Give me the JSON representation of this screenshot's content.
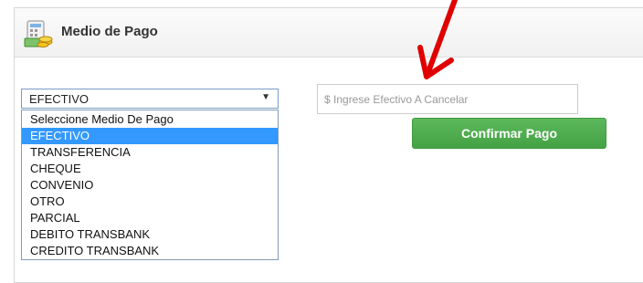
{
  "panel": {
    "title": "Medio de Pago"
  },
  "payment_select": {
    "selected": "EFECTIVO",
    "options": [
      "Seleccione Medio De Pago",
      "EFECTIVO",
      "TRANSFERENCIA",
      "CHEQUE",
      "CONVENIO",
      "OTRO",
      "PARCIAL",
      "DEBITO TRANSBANK",
      "CREDITO TRANSBANK"
    ],
    "highlighted_option": "EFECTIVO"
  },
  "cash_input": {
    "placeholder": "$ Ingrese Efectivo A Cancelar",
    "value": ""
  },
  "confirm_button": {
    "label": "Confirmar Pago"
  },
  "colors": {
    "confirm_green": "#5cb85c",
    "highlight_blue": "#3399ff",
    "annotation_red": "#e00000"
  },
  "icons": {
    "header": "payment-money-icon",
    "annotation": "red-arrow-icon"
  }
}
